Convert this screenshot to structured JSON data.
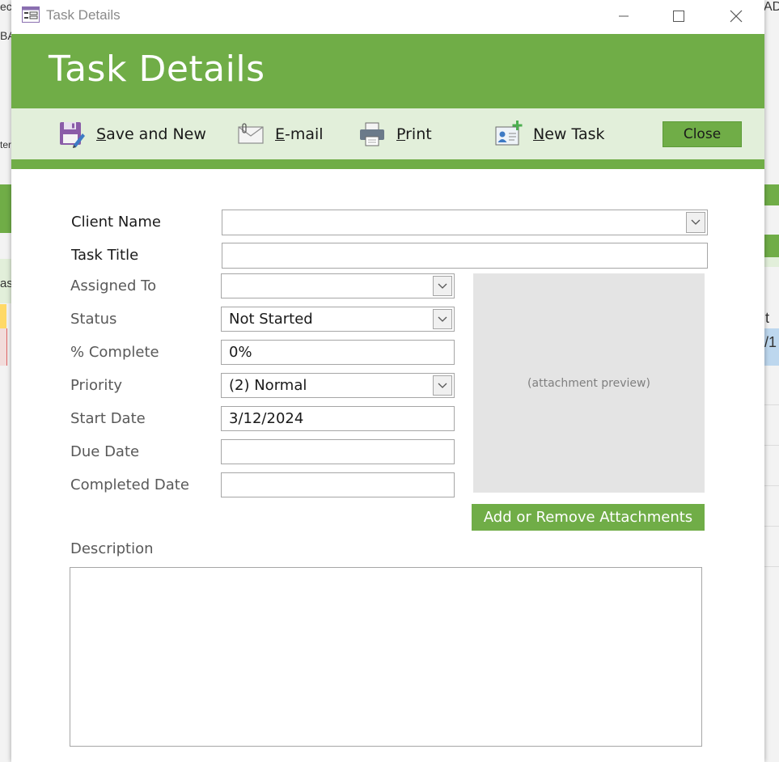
{
  "window": {
    "title": "Task Details"
  },
  "header": {
    "title": "Task Details"
  },
  "toolbar": {
    "save_new": {
      "key": "S",
      "rest": "ave and New",
      "icon": "save-icon"
    },
    "email": {
      "key": "E",
      "rest": "-mail",
      "icon": "email-icon"
    },
    "print": {
      "key": "P",
      "rest": "rint",
      "icon": "printer-icon"
    },
    "new_task": {
      "key": "N",
      "rest": "ew Task",
      "icon": "contact-card-add-icon"
    },
    "close_label": "Close"
  },
  "form": {
    "client_name": {
      "label": "Client Name",
      "value": ""
    },
    "task_title": {
      "label": "Task Title",
      "value": ""
    },
    "assigned_to": {
      "label": "Assigned To",
      "value": ""
    },
    "status": {
      "label": "Status",
      "value": "Not Started"
    },
    "percent_complete": {
      "label": "% Complete",
      "value": "0%"
    },
    "priority": {
      "label": "Priority",
      "value": "(2) Normal"
    },
    "start_date": {
      "label": "Start Date",
      "value": "3/12/2024"
    },
    "due_date": {
      "label": "Due Date",
      "value": ""
    },
    "completed_date": {
      "label": "Completed Date",
      "value": ""
    },
    "description": {
      "label": "Description",
      "value": ""
    }
  },
  "attachments": {
    "preview_text": "(attachment preview)",
    "button_label": "Add or Remove Attachments"
  },
  "background_app": {
    "fragments": [
      "ec",
      "BA",
      "ter",
      "as",
      "AD",
      "t D",
      "/1"
    ]
  },
  "colors": {
    "accent": "#70ad47",
    "toolbar_bg": "#e2efda",
    "preview_bg": "#e4e4e4"
  }
}
